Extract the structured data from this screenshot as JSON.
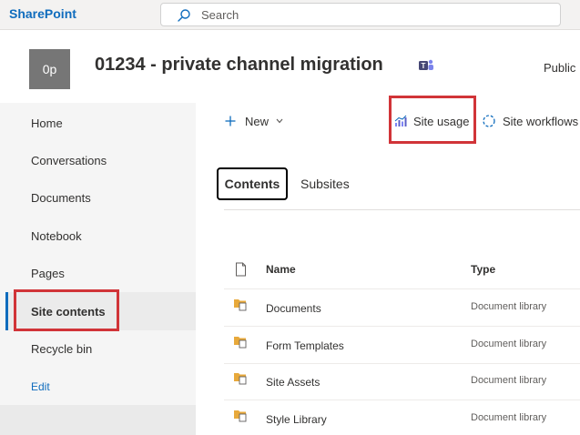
{
  "topbar": {
    "brand": "SharePoint",
    "search_placeholder": "Search"
  },
  "site": {
    "logo_text": "0p",
    "title": "01234 - private channel migration",
    "visibility": "Public"
  },
  "nav": {
    "items": [
      {
        "label": "Home"
      },
      {
        "label": "Conversations"
      },
      {
        "label": "Documents"
      },
      {
        "label": "Notebook"
      },
      {
        "label": "Pages"
      },
      {
        "label": "Site contents"
      },
      {
        "label": "Recycle bin"
      }
    ],
    "selected": "Site contents",
    "edit_label": "Edit"
  },
  "commands": {
    "new_label": "New",
    "site_usage_label": "Site usage",
    "site_workflows_label": "Site workflows"
  },
  "tabs": [
    {
      "label": "Contents",
      "active": true
    },
    {
      "label": "Subsites",
      "active": false
    }
  ],
  "table": {
    "columns": [
      "Name",
      "Type"
    ],
    "rows": [
      {
        "name": "Documents",
        "type": "Document library"
      },
      {
        "name": "Form Templates",
        "type": "Document library"
      },
      {
        "name": "Site Assets",
        "type": "Document library"
      },
      {
        "name": "Style Library",
        "type": "Document library"
      }
    ]
  },
  "colors": {
    "brand": "#0f6cbd",
    "highlight": "#d13438",
    "folder": "#c19c00"
  }
}
